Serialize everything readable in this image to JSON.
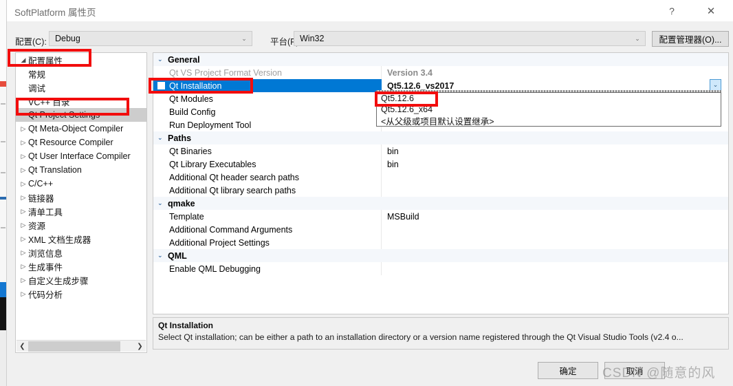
{
  "window": {
    "title": "SoftPlatform 属性页",
    "help_icon": "?",
    "close_icon": "✕"
  },
  "config_bar": {
    "config_label": "配置(C):",
    "config_value": "Debug",
    "platform_label": "平台(P):",
    "platform_value": "Win32",
    "config_manager_button": "配置管理器(O)...",
    "chevron": "⌄"
  },
  "tree": {
    "items": [
      {
        "label": "配置属性",
        "level": 0,
        "arrow": "◢",
        "selected": false
      },
      {
        "label": "常规",
        "level": 1,
        "arrow": "",
        "selected": false
      },
      {
        "label": "调试",
        "level": 1,
        "arrow": "",
        "selected": false
      },
      {
        "label": "VC++ 目录",
        "level": 1,
        "arrow": "",
        "selected": false
      },
      {
        "label": "Qt Project Settings",
        "level": 1,
        "arrow": "",
        "selected": true
      },
      {
        "label": "Qt Meta-Object Compiler",
        "level": 1,
        "arrow": "▷",
        "selected": false
      },
      {
        "label": "Qt Resource Compiler",
        "level": 1,
        "arrow": "▷",
        "selected": false
      },
      {
        "label": "Qt User Interface Compiler",
        "level": 1,
        "arrow": "▷",
        "selected": false
      },
      {
        "label": "Qt Translation",
        "level": 1,
        "arrow": "▷",
        "selected": false
      },
      {
        "label": "C/C++",
        "level": 1,
        "arrow": "▷",
        "selected": false
      },
      {
        "label": "链接器",
        "level": 1,
        "arrow": "▷",
        "selected": false
      },
      {
        "label": "清单工具",
        "level": 1,
        "arrow": "▷",
        "selected": false
      },
      {
        "label": "资源",
        "level": 1,
        "arrow": "▷",
        "selected": false
      },
      {
        "label": "XML 文档生成器",
        "level": 1,
        "arrow": "▷",
        "selected": false
      },
      {
        "label": "浏览信息",
        "level": 1,
        "arrow": "▷",
        "selected": false
      },
      {
        "label": "生成事件",
        "level": 1,
        "arrow": "▷",
        "selected": false
      },
      {
        "label": "自定义生成步骤",
        "level": 1,
        "arrow": "▷",
        "selected": false
      },
      {
        "label": "代码分析",
        "level": 1,
        "arrow": "▷",
        "selected": false
      }
    ],
    "scroll_left_arrow": "❮",
    "scroll_right_arrow": "❯"
  },
  "grid": {
    "rows": [
      {
        "kind": "group",
        "name": "General",
        "value": "",
        "chevron": "⌄"
      },
      {
        "kind": "prop",
        "name": "Qt VS Project Format Version",
        "value": "Version 3.4",
        "state": "dim"
      },
      {
        "kind": "prop",
        "name": "Qt Installation",
        "value": "Qt5.12.6_vs2017",
        "state": "selected"
      },
      {
        "kind": "prop",
        "name": "Qt Modules",
        "value": "",
        "state": "normal"
      },
      {
        "kind": "prop",
        "name": "Build Config",
        "value": "",
        "state": "normal"
      },
      {
        "kind": "prop",
        "name": "Run Deployment Tool",
        "value": "",
        "state": "normal"
      },
      {
        "kind": "group",
        "name": "Paths",
        "value": "",
        "chevron": "⌄"
      },
      {
        "kind": "prop",
        "name": "Qt Binaries",
        "value": "bin",
        "state": "normal"
      },
      {
        "kind": "prop",
        "name": "Qt Library Executables",
        "value": "bin",
        "state": "normal"
      },
      {
        "kind": "prop",
        "name": "Additional Qt header search paths",
        "value": "",
        "state": "normal"
      },
      {
        "kind": "prop",
        "name": "Additional Qt library search paths",
        "value": "",
        "state": "normal"
      },
      {
        "kind": "group",
        "name": "qmake",
        "value": "",
        "chevron": "⌄"
      },
      {
        "kind": "prop",
        "name": "Template",
        "value": "MSBuild",
        "state": "normal"
      },
      {
        "kind": "prop",
        "name": "Additional Command Arguments",
        "value": "",
        "state": "normal"
      },
      {
        "kind": "prop",
        "name": "Additional Project Settings",
        "value": "",
        "state": "normal"
      },
      {
        "kind": "group",
        "name": "QML",
        "value": "",
        "chevron": "⌄"
      },
      {
        "kind": "prop",
        "name": "Enable QML Debugging",
        "value": "",
        "state": "normal"
      }
    ]
  },
  "dropdown": {
    "open": true,
    "button_chevron": "⌄",
    "options": [
      "Qt5.12.6",
      "Qt5.12.6_x64",
      "<从父级或项目默认设置继承>"
    ]
  },
  "description": {
    "title": "Qt Installation",
    "body": "Select Qt installation; can be either a path to an installation directory or a version name registered through the Qt Visual Studio Tools (v2.4 o..."
  },
  "footer": {
    "ok_button": "确定",
    "cancel_button": "取消"
  },
  "watermark": "CSDN @随意的风",
  "colors": {
    "selection_blue": "#0078d4",
    "annotation_red": "#f20d0d",
    "group_header_bg": "#f4f7fb",
    "tree_selection_gray": "#cdcdcd"
  }
}
